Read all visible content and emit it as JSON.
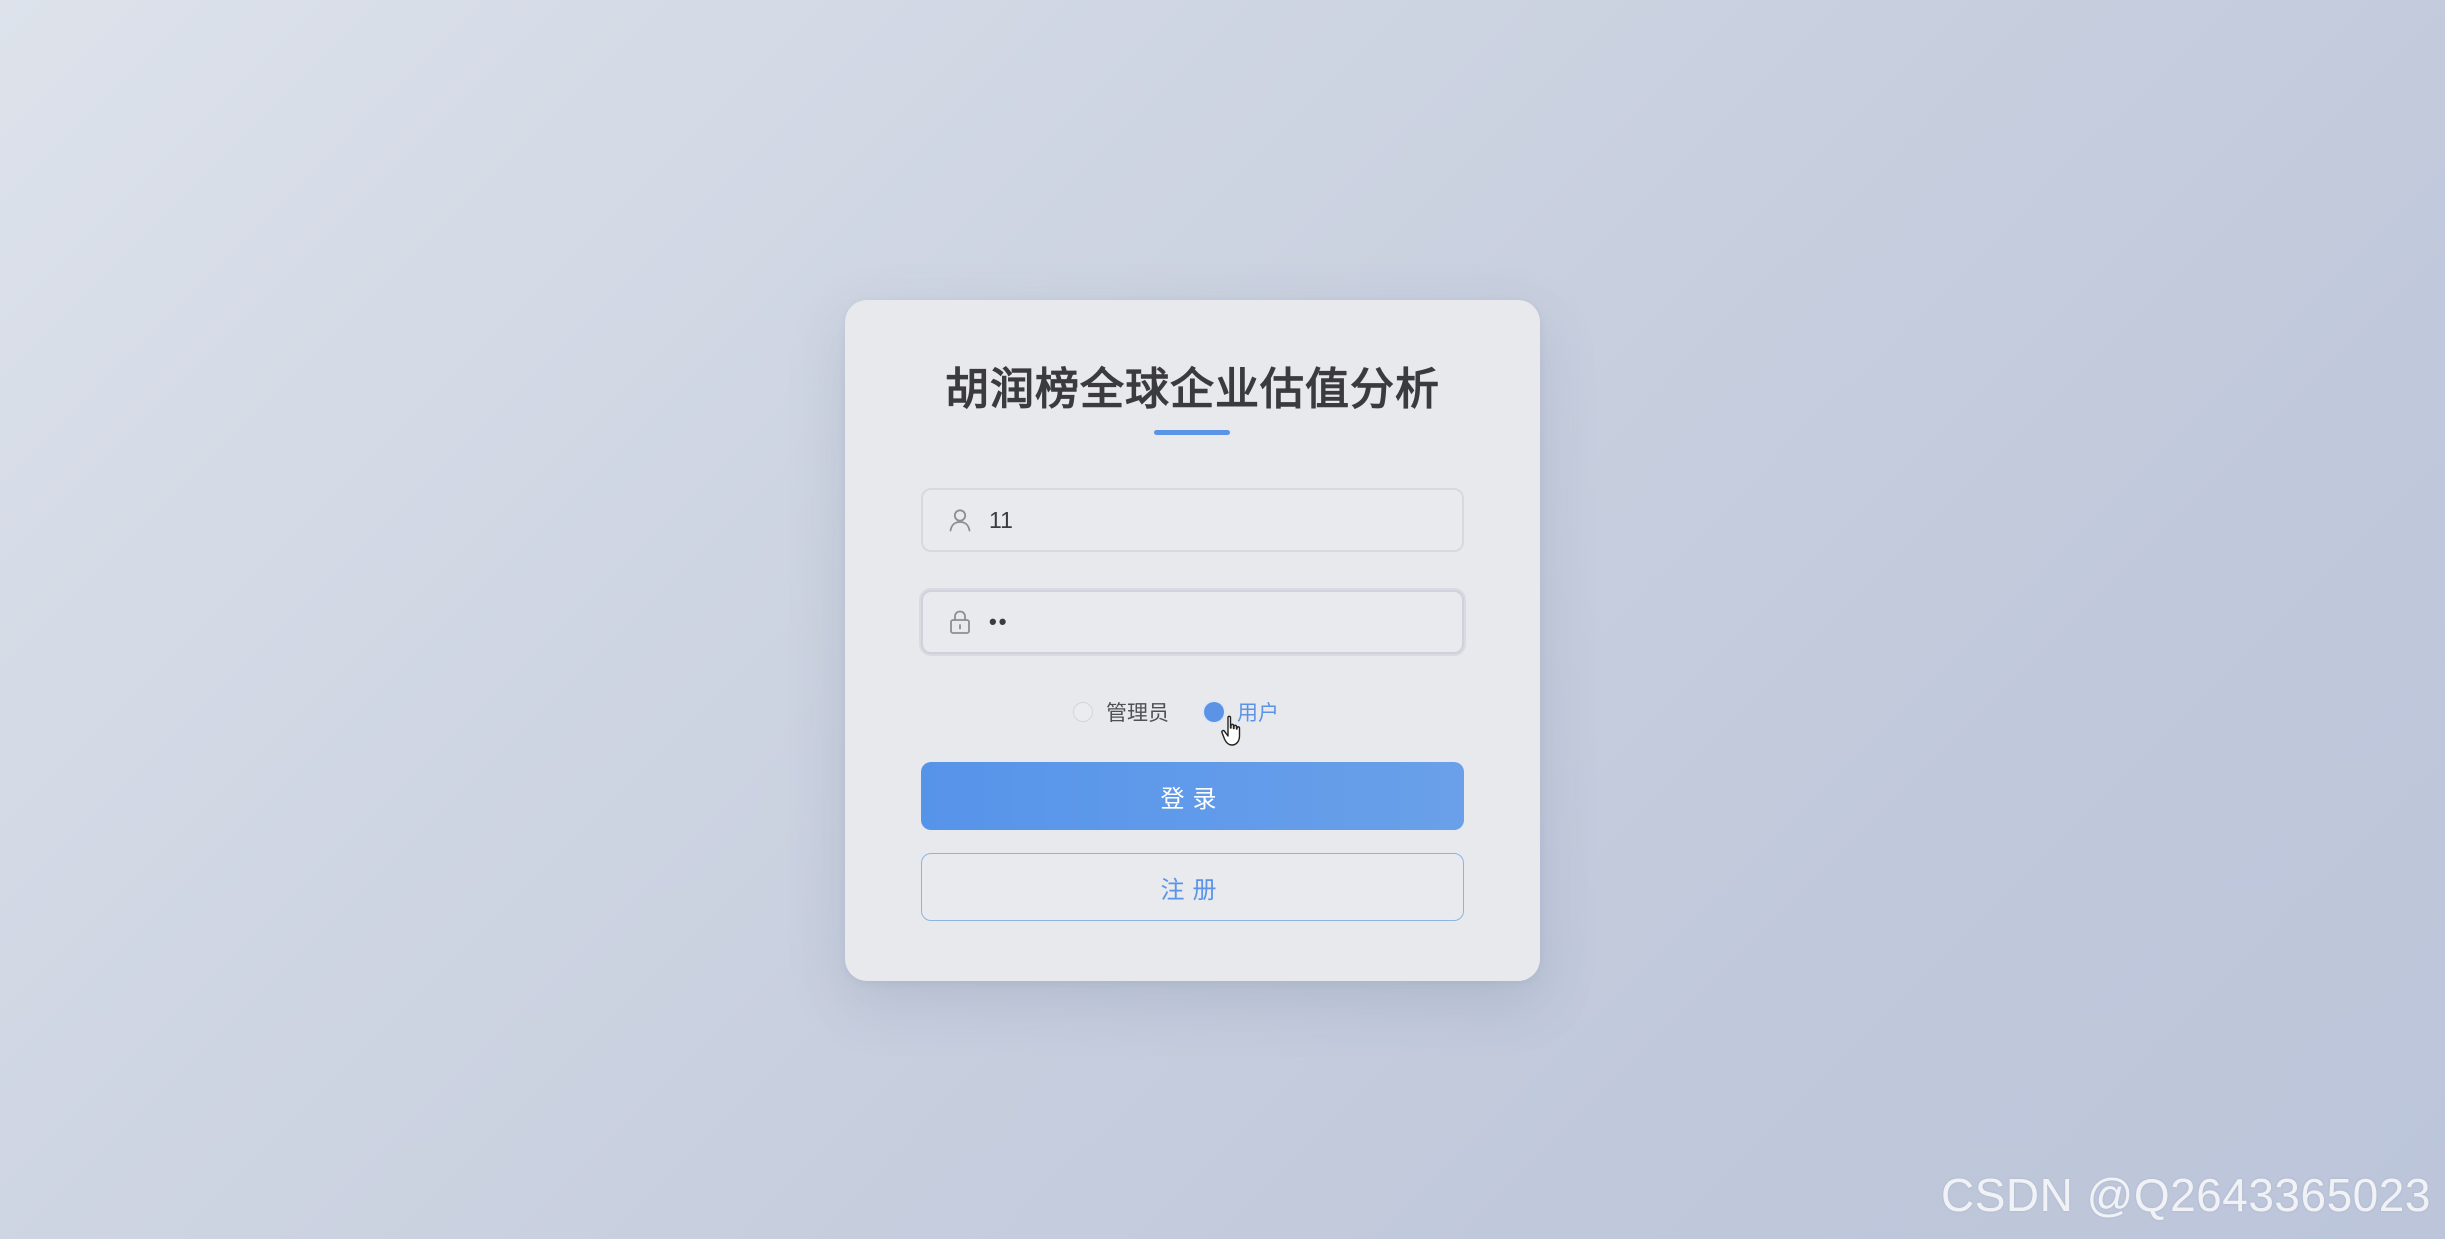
{
  "app": {
    "title": "胡润榜全球企业估值分析"
  },
  "form": {
    "username": {
      "value": "11",
      "icon": "user-icon"
    },
    "password": {
      "value": "••",
      "icon": "lock-icon"
    },
    "roles": [
      {
        "label": "管理员",
        "selected": false
      },
      {
        "label": "用户",
        "selected": true
      }
    ],
    "login_label": "登录",
    "register_label": "注册"
  },
  "colors": {
    "accent": "#5b93e6",
    "card_bg": "#e8e9ec",
    "title_text": "#3b3b3d"
  },
  "watermark": {
    "text": "CSDN @Q2643365023"
  }
}
